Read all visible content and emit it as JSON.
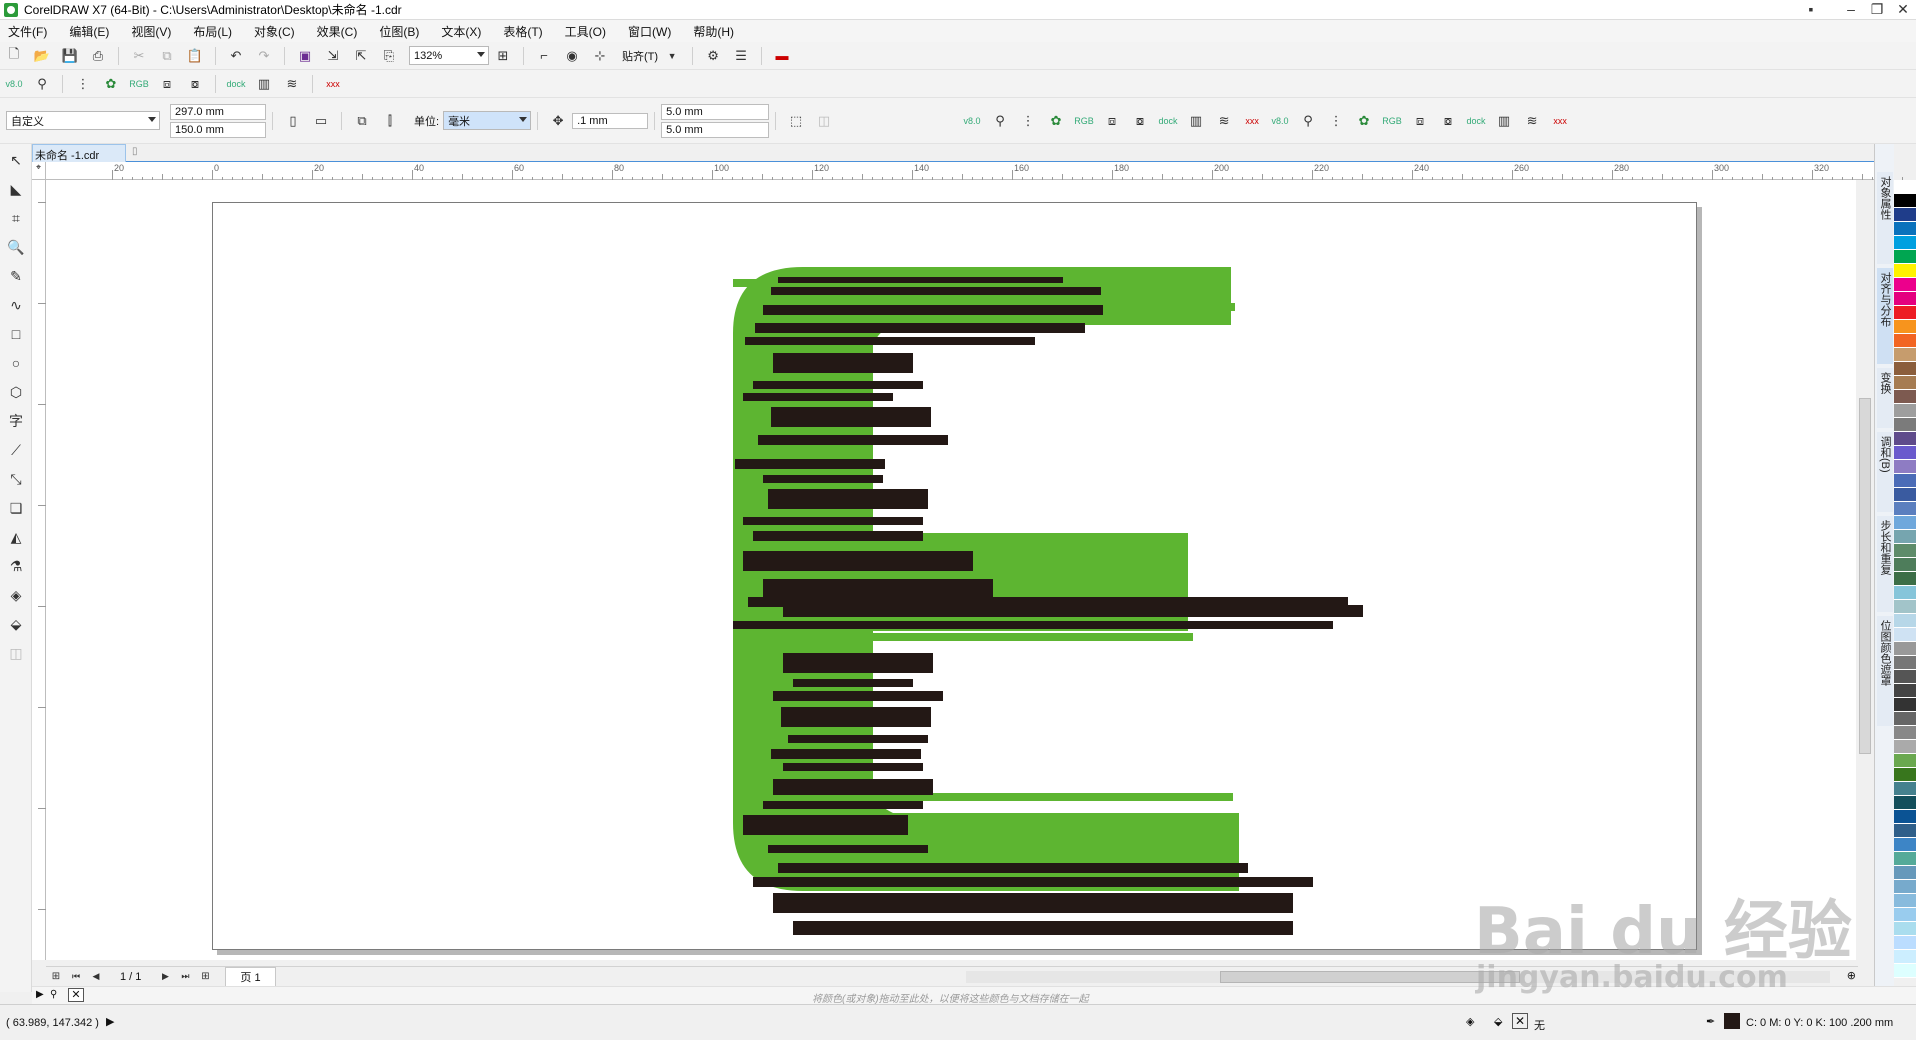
{
  "window": {
    "title": "CorelDRAW X7 (64-Bit) - C:\\Users\\Administrator\\Desktop\\未命名 -1.cdr",
    "controls": [
      "minimize",
      "restore",
      "close"
    ]
  },
  "menu": [
    "文件(F)",
    "编辑(E)",
    "视图(V)",
    "布局(L)",
    "对象(C)",
    "效果(C)",
    "位图(B)",
    "文本(X)",
    "表格(T)",
    "工具(O)",
    "窗口(W)",
    "帮助(H)"
  ],
  "standard_toolbar": {
    "zoom": "132%",
    "snap_label": "贴齐(T)"
  },
  "property_bar": {
    "preset": "自定义",
    "width": "297.0 mm",
    "height": "150.0 mm",
    "units_label": "单位:",
    "units": "毫米",
    "nudge": ".1 mm",
    "dup_x": "5.0 mm",
    "dup_y": "5.0 mm"
  },
  "document": {
    "tab": "未命名 -1.cdr"
  },
  "ruler": {
    "h_labels": [
      "20",
      "0",
      "20",
      "40",
      "60",
      "80",
      "100",
      "120",
      "140",
      "160",
      "180",
      "200",
      "220",
      "240",
      "260",
      "280",
      "300",
      "320"
    ],
    "units": "毫米"
  },
  "dockers": [
    "对象属性",
    "对齐与分布",
    "变换",
    "调和(B)",
    "步长和重复",
    "位图颜色遮罩"
  ],
  "page_nav": {
    "counter": "1 / 1",
    "page_tab": "页 1"
  },
  "color_dock_hint": "将颜色(或对象)拖动至此处，以便将这些颜色与文档存储在一起",
  "status": {
    "coords": "( 63.989, 147.342 )",
    "fill": "无",
    "outline": "C: 0 M: 0 Y: 0 K: 100  .200 mm"
  },
  "watermark": {
    "brand": "Bai du 经验",
    "url": "jingyan.baidu.com"
  },
  "colors": {
    "green": "#5db531",
    "dark": "#231815",
    "accent": "#4a90d9"
  },
  "palette": [
    "#ffffff",
    "#000000",
    "#1f3d8a",
    "#0a72bc",
    "#00a0e0",
    "#00a651",
    "#fff200",
    "#ec008c",
    "#e4007f",
    "#ed1c24",
    "#f7941d",
    "#f26522",
    "#c69c6d",
    "#8b5e3c",
    "#a67c52",
    "#7d5a50",
    "#9e9e9e",
    "#7b7b7b",
    "#5f4b8b",
    "#6a5acd",
    "#8e7cc3",
    "#4b6cb7",
    "#3a5ba0",
    "#5b7fbf",
    "#6fa8dc",
    "#76a5af",
    "#5e8c6a",
    "#4e7d5b",
    "#3c6e47",
    "#86c5da",
    "#a2c4c9",
    "#b7d7e8",
    "#cfe2f3",
    "#999999",
    "#777777",
    "#555555",
    "#444444",
    "#333333",
    "#666666",
    "#888888",
    "#aaaaaa",
    "#6aa84f",
    "#38761d",
    "#45818e",
    "#134f5c",
    "#0b5394",
    "#2f5f8a",
    "#3d85c6",
    "#5a9",
    "#69b",
    "#7ac",
    "#8bd",
    "#9ce",
    "#ade",
    "#bdf",
    "#cef",
    "#dff"
  ]
}
